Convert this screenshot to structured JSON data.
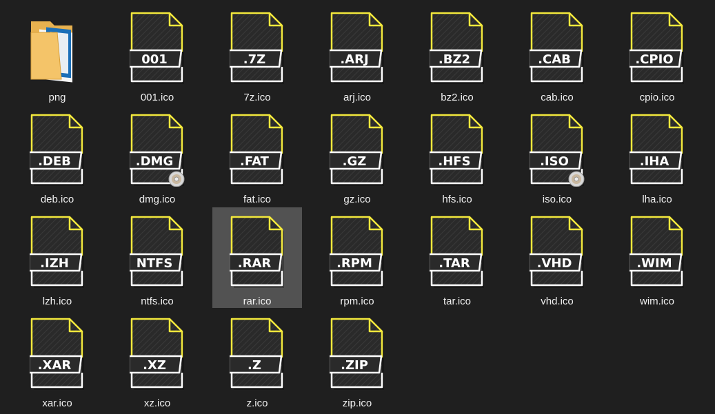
{
  "files": [
    {
      "name": "png",
      "ext": "",
      "kind": "folder"
    },
    {
      "name": "001.ico",
      "ext": "001",
      "kind": "archive"
    },
    {
      "name": "7z.ico",
      "ext": ".7Z",
      "kind": "archive"
    },
    {
      "name": "arj.ico",
      "ext": ".ARJ",
      "kind": "archive"
    },
    {
      "name": "bz2.ico",
      "ext": ".BZ2",
      "kind": "archive"
    },
    {
      "name": "cab.ico",
      "ext": ".CAB",
      "kind": "archive"
    },
    {
      "name": "cpio.ico",
      "ext": ".CPIO",
      "kind": "archive"
    },
    {
      "name": "deb.ico",
      "ext": ".DEB",
      "kind": "archive"
    },
    {
      "name": "dmg.ico",
      "ext": ".DMG",
      "kind": "archive",
      "disc": true
    },
    {
      "name": "fat.ico",
      "ext": ".FAT",
      "kind": "archive"
    },
    {
      "name": "gz.ico",
      "ext": ".GZ",
      "kind": "archive"
    },
    {
      "name": "hfs.ico",
      "ext": ".HFS",
      "kind": "archive"
    },
    {
      "name": "iso.ico",
      "ext": ".ISO",
      "kind": "archive",
      "disc": true
    },
    {
      "name": "lha.ico",
      "ext": ".IHA",
      "kind": "archive"
    },
    {
      "name": "lzh.ico",
      "ext": ".IZH",
      "kind": "archive"
    },
    {
      "name": "ntfs.ico",
      "ext": "NTFS",
      "kind": "archive"
    },
    {
      "name": "rar.ico",
      "ext": ".RAR",
      "kind": "archive",
      "selected": true
    },
    {
      "name": "rpm.ico",
      "ext": ".RPM",
      "kind": "archive"
    },
    {
      "name": "tar.ico",
      "ext": ".TAR",
      "kind": "archive"
    },
    {
      "name": "vhd.ico",
      "ext": ".VHD",
      "kind": "archive"
    },
    {
      "name": "wim.ico",
      "ext": ".WIM",
      "kind": "archive"
    },
    {
      "name": "xar.ico",
      "ext": ".XAR",
      "kind": "archive"
    },
    {
      "name": "xz.ico",
      "ext": ".XZ",
      "kind": "archive"
    },
    {
      "name": "z.ico",
      "ext": ".Z",
      "kind": "archive"
    },
    {
      "name": "zip.ico",
      "ext": ".ZIP",
      "kind": "archive"
    }
  ],
  "colors": {
    "background": "#1f1f1f",
    "icon_body": "#2a2a2a",
    "icon_accent": "#f2e83c",
    "icon_outline": "#ffffff",
    "selection": "#525252",
    "folder": "#f4c469"
  }
}
